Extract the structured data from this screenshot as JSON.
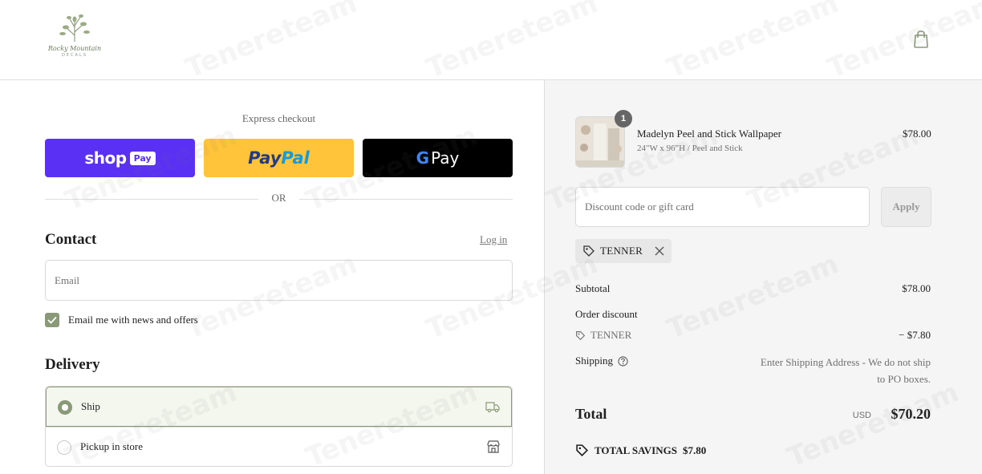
{
  "header": {
    "logo_line1": "Rocky Mountain",
    "logo_line2": "DECALS"
  },
  "express": {
    "title": "Express checkout",
    "shop_label": "shop",
    "shop_pay_label": "Pay",
    "paypal_label_1": "Pay",
    "paypal_label_2": "Pal",
    "gpay_label": "Pay"
  },
  "or_label": "OR",
  "contact": {
    "title": "Contact",
    "login_label": "Log in",
    "email_placeholder": "Email",
    "news_label": "Email me with news and offers",
    "news_checked": true
  },
  "delivery": {
    "title": "Delivery",
    "options": [
      {
        "label": "Ship",
        "selected": true
      },
      {
        "label": "Pickup in store",
        "selected": false
      }
    ]
  },
  "order": {
    "item": {
      "name": "Madelyn Peel and Stick Wallpaper",
      "variant": "24\"W x 96\"H / Peel and Stick",
      "price": "$78.00",
      "qty": "1"
    },
    "discount_placeholder": "Discount code or gift card",
    "apply_label": "Apply",
    "code": "TENNER",
    "subtotal_label": "Subtotal",
    "subtotal_value": "$78.00",
    "order_discount_label": "Order discount",
    "discount_code_label": "TENNER",
    "discount_value": "− $7.80",
    "shipping_label": "Shipping",
    "shipping_note": "Enter Shipping Address - We do not ship to PO boxes.",
    "total_label": "Total",
    "currency": "USD",
    "total_value": "$70.20",
    "savings_label": "TOTAL SAVINGS",
    "savings_value": "$7.80"
  },
  "colors": {
    "shop_pay": "#5a31f4",
    "paypal": "#ffc439",
    "gpay": "#000000",
    "accent": "#8a9a78"
  },
  "watermark": "Tenereteam"
}
